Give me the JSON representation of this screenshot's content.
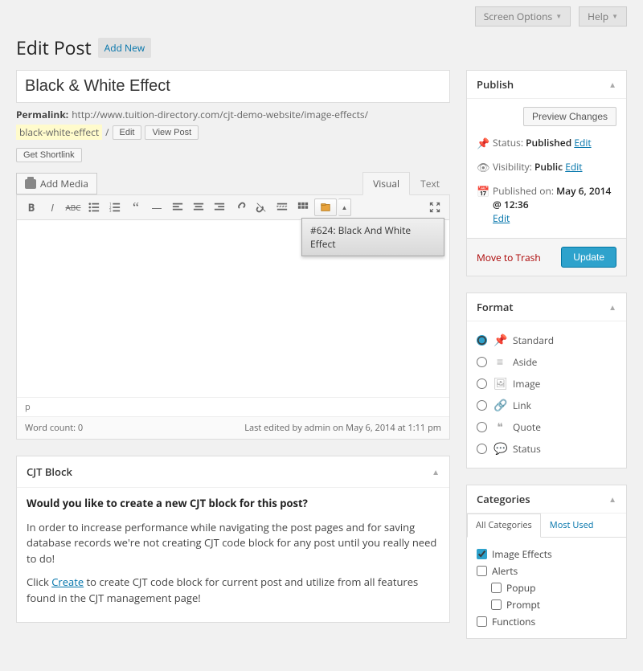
{
  "topbar": {
    "screen_options": "Screen Options",
    "help": "Help"
  },
  "header": {
    "title": "Edit Post",
    "add_new": "Add New"
  },
  "post": {
    "title": "Black & White Effect",
    "permalink_label": "Permalink:",
    "permalink_base": "http://www.tuition-directory.com/cjt-demo-website/image-effects/",
    "slug": "black-white-effect",
    "edit_btn": "Edit",
    "view_btn": "View Post",
    "shortlink_btn": "Get Shortlink"
  },
  "editor": {
    "add_media": "Add Media",
    "tab_visual": "Visual",
    "tab_text": "Text",
    "dropdown_item": "#624: Black And White Effect",
    "path": "p",
    "word_count_label": "Word count: 0",
    "last_edited": "Last edited by admin on May 6, 2014 at 1:11 pm"
  },
  "cjt": {
    "title": "CJT Block",
    "q": "Would you like to create a new CJT block for this post?",
    "p1": "In order to increase performance while navigating the post pages and for saving database records we're not creating CJT code block for any post until you really need to do!",
    "p2a": "Click ",
    "p2link": "Create",
    "p2b": " to create CJT code block for current post and utilize from all features found in the CJT management page!"
  },
  "publish": {
    "title": "Publish",
    "preview": "Preview Changes",
    "status_label": "Status:",
    "status_value": "Published",
    "visibility_label": "Visibility:",
    "visibility_value": "Public",
    "published_label": "Published on:",
    "published_value": "May 6, 2014 @ 12:36",
    "edit": "Edit",
    "trash": "Move to Trash",
    "update": "Update"
  },
  "format": {
    "title": "Format",
    "items": [
      "Standard",
      "Aside",
      "Image",
      "Link",
      "Quote",
      "Status"
    ],
    "selected": 0
  },
  "categories": {
    "title": "Categories",
    "tab_all": "All Categories",
    "tab_used": "Most Used",
    "items": [
      {
        "label": "Image Effects",
        "checked": true,
        "indent": 0
      },
      {
        "label": "Alerts",
        "checked": false,
        "indent": 0
      },
      {
        "label": "Popup",
        "checked": false,
        "indent": 1
      },
      {
        "label": "Prompt",
        "checked": false,
        "indent": 1
      },
      {
        "label": "Functions",
        "checked": false,
        "indent": 0
      }
    ]
  }
}
